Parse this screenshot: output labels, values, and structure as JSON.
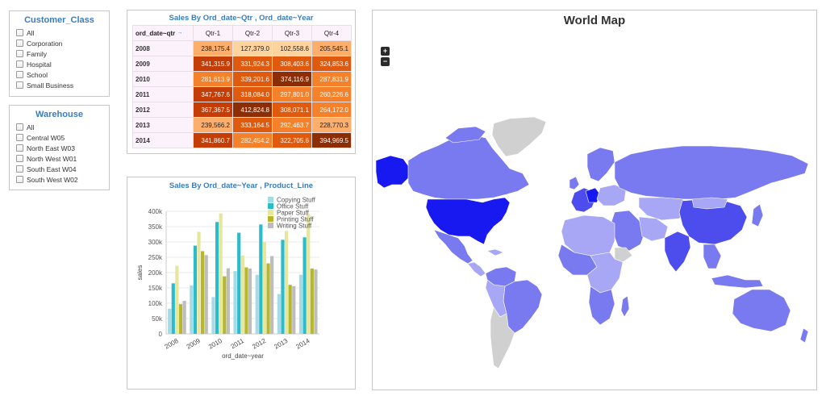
{
  "customer_filter": {
    "title": "Customer_Class",
    "options": [
      "All",
      "Corporation",
      "Family",
      "Hospital",
      "School",
      "Small Business"
    ]
  },
  "warehouse_filter": {
    "title": "Warehouse",
    "options": [
      "All",
      "Central W05",
      "North East W03",
      "North West W01",
      "South East W04",
      "South West W02"
    ]
  },
  "pivot": {
    "title": "Sales By Ord_date~Qtr , Ord_date~Year",
    "corner_label": "ord_date~qtr",
    "corner_arrow": "→",
    "columns": [
      "Qtr-1",
      "Qtr-2",
      "Qtr-3",
      "Qtr-4"
    ],
    "rows": [
      {
        "year": "2008",
        "values": [
          "238,175.4",
          "127,379.0",
          "102,558.6",
          "205,545.1"
        ]
      },
      {
        "year": "2009",
        "values": [
          "341,315.9",
          "331,924.3",
          "308,403.6",
          "324,853.6"
        ]
      },
      {
        "year": "2010",
        "values": [
          "281,613.9",
          "339,201.6",
          "374,116.9",
          "287,831.9"
        ]
      },
      {
        "year": "2011",
        "values": [
          "347,767.6",
          "318,084.0",
          "297,801.0",
          "260,226.6"
        ]
      },
      {
        "year": "2012",
        "values": [
          "367,367.5",
          "412,824.8",
          "308,071.1",
          "264,172.0"
        ]
      },
      {
        "year": "2013",
        "values": [
          "239,566.2",
          "333,164.5",
          "292,463.7",
          "228,770.3"
        ]
      },
      {
        "year": "2014",
        "values": [
          "341,860.7",
          "282,454.2",
          "322,705.6",
          "394,969.5"
        ]
      }
    ]
  },
  "chart_data": {
    "type": "bar",
    "title": "Sales By Ord_date~Year , Product_Line",
    "xlabel": "ord_date~year",
    "ylabel": "sales",
    "categories": [
      "2008",
      "2009",
      "2010",
      "2011",
      "2012",
      "2013",
      "2014"
    ],
    "y_ticks": [
      "0",
      "50k",
      "100k",
      "150k",
      "200k",
      "250k",
      "300k",
      "350k",
      "400k"
    ],
    "ylim": [
      0,
      400000
    ],
    "legend_position": "top-right",
    "series": [
      {
        "name": "Copying Stuff",
        "color": "#a6dbe6",
        "values": [
          82000,
          158000,
          120000,
          205000,
          193000,
          130000,
          193000
        ]
      },
      {
        "name": "Office Stuff",
        "color": "#2bbccc",
        "values": [
          165000,
          288000,
          365000,
          330000,
          357000,
          307000,
          315000
        ]
      },
      {
        "name": "Paper Stuff",
        "color": "#e6e69c",
        "values": [
          222000,
          333000,
          393000,
          256000,
          300000,
          336000,
          390000
        ]
      },
      {
        "name": "Printing Stuff",
        "color": "#b7b72d",
        "values": [
          97000,
          270000,
          188000,
          217000,
          230000,
          160000,
          213000
        ]
      },
      {
        "name": "Writing Stuff",
        "color": "#bdbdbd",
        "values": [
          108000,
          257000,
          214000,
          213000,
          254000,
          156000,
          210000
        ]
      }
    ]
  },
  "map": {
    "title": "World Map",
    "zoom_in": "+",
    "zoom_out": "−",
    "colors": {
      "very_light": "#a7a7f5",
      "light": "#8b8bf2",
      "medium": "#7a7af0",
      "dark": "#4d4dee",
      "darkest": "#1818f0",
      "no_data": "#d0d0d0"
    }
  },
  "heat_colors": {
    "lightest": "#fdd49e",
    "light": "#fdae6b",
    "mid": "#f5822a",
    "dark": "#e05a0e",
    "darker": "#c43d05",
    "darkest": "#8c2d04"
  }
}
